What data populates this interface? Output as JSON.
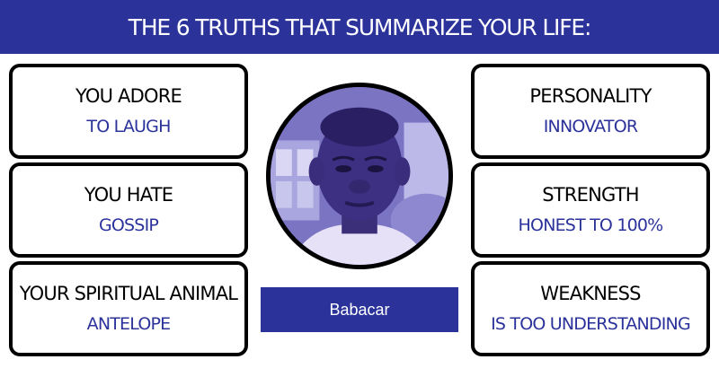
{
  "banner": {
    "title": "THE 6 TRUTHS THAT SUMMARIZE YOUR LIFE:"
  },
  "left_cards": [
    {
      "label": "YOU ADORE",
      "value": "TO LAUGH"
    },
    {
      "label": "YOU HATE",
      "value": "GOSSIP"
    },
    {
      "label": "YOUR SPIRITUAL ANIMAL",
      "value": "ANTELOPE"
    }
  ],
  "right_cards": [
    {
      "label": "PERSONALITY",
      "value": "INNOVATOR"
    },
    {
      "label": "STRENGTH",
      "value": "HONEST TO 100%"
    },
    {
      "label": "WEAKNESS",
      "value": "IS TOO UNDERSTANDING"
    }
  ],
  "profile": {
    "name": "Babacar"
  },
  "colors": {
    "accent": "#2b339b",
    "border": "#000000",
    "background": "#ffffff"
  }
}
